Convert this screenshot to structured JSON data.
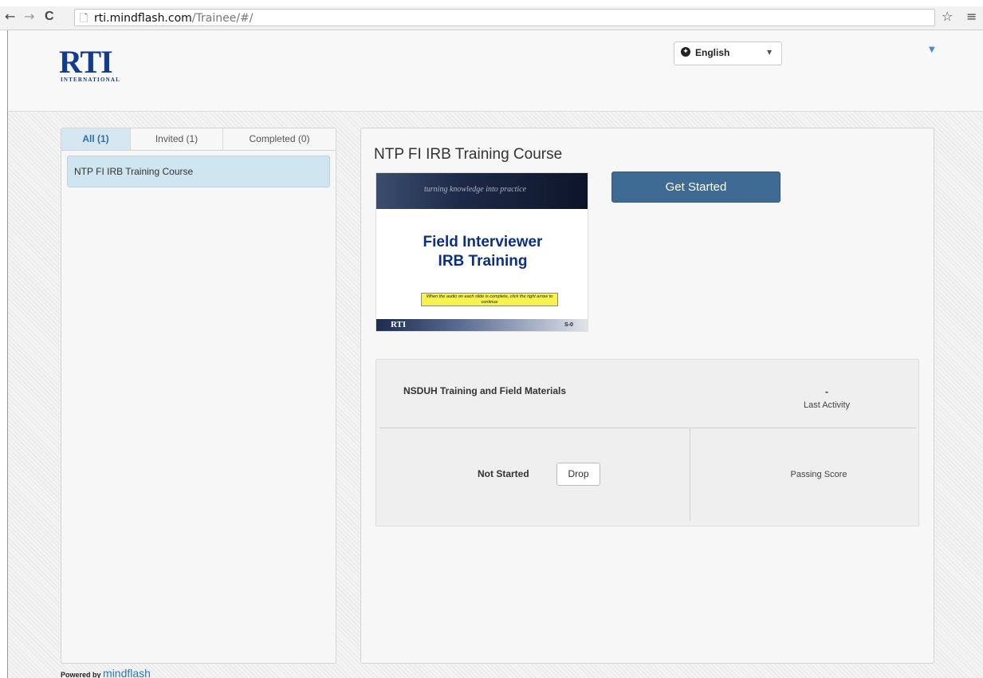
{
  "browser": {
    "url_host": "rti.mindflash.com",
    "url_path": "/Trainee/#/",
    "back_glyph": "←",
    "forward_glyph": "→",
    "reload_glyph": "C",
    "star_glyph": "☆",
    "menu_glyph": "≡",
    "page_icon_glyph": "🗋"
  },
  "header": {
    "logo_text": "RTI",
    "logo_subtext": "INTERNATIONAL",
    "language": "English",
    "account_caret": "▼"
  },
  "sidebar": {
    "tabs": [
      {
        "label": "All (1)",
        "active": true
      },
      {
        "label": "Invited (1)",
        "active": false
      },
      {
        "label": "Completed (0)",
        "active": false
      }
    ],
    "courses": [
      "NTP FI IRB Training Course"
    ]
  },
  "footer": {
    "powered_by": "Powered by",
    "brand": "mindflash"
  },
  "course": {
    "title": "NTP FI IRB Training Course",
    "get_started_label": "Get Started",
    "thumbnail": {
      "banner_text": "turning knowledge into practice",
      "slide_title_line1": "Field Interviewer",
      "slide_title_line2": "IRB Training",
      "note": "When the audio on each slide is complete, click the right arrow to continue",
      "footer_logo": "RTI",
      "slide_number": "S-0"
    },
    "materials": {
      "title": "NSDUH Training and Field Materials",
      "last_activity_value": "-",
      "last_activity_label": "Last Activity",
      "status": "Not Started",
      "drop_label": "Drop",
      "passing_score_label": "Passing Score"
    }
  },
  "colors": {
    "primary_button": "#3e6a94",
    "active_tab": "#d7e7f2",
    "selected_item": "#cfe5f0",
    "logo": "#143c8c"
  }
}
